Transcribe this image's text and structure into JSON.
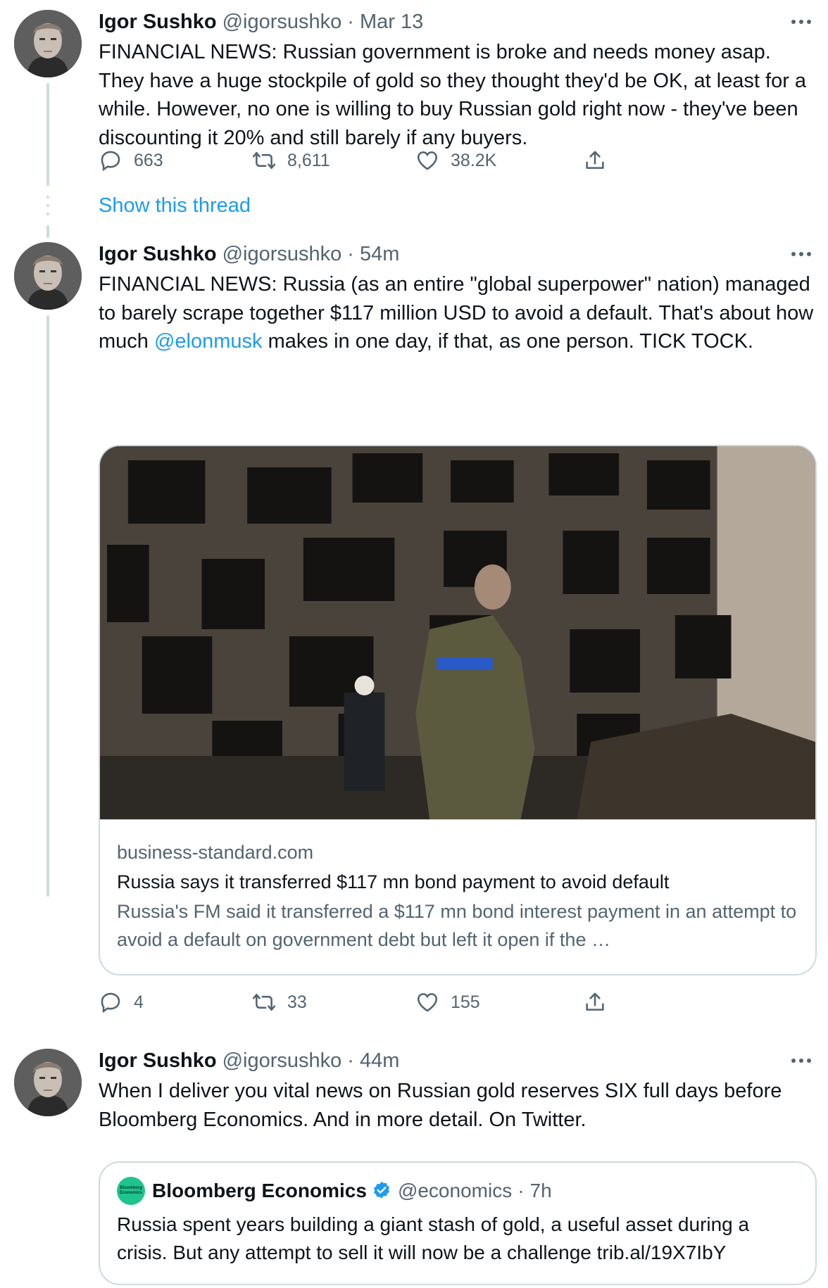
{
  "colors": {
    "link": "#1d9bf0",
    "muted": "#536471",
    "border": "#cfd9de",
    "text": "#0f1419"
  },
  "tweets": [
    {
      "name": "Igor Sushko",
      "handle": "@igorsushko",
      "separator": "·",
      "time": "Mar 13",
      "text": "FINANCIAL NEWS: Russian government is broke and needs money asap. They have a huge stockpile of gold so they thought they'd be OK, at least for a while. However, no one is willing to buy Russian gold right now - they've been discounting it 20% and still barely if any buyers.",
      "replies": "663",
      "retweets": "8,611",
      "likes": "38.2K"
    },
    {
      "name": "Igor Sushko",
      "handle": "@igorsushko",
      "separator": "·",
      "time": "54m",
      "text_before": "FINANCIAL NEWS: Russia (as an entire \"global superpower\" nation) managed to barely scrape together $117 million USD to avoid a default. That's about how much ",
      "mention": "@elonmusk",
      "text_after": " makes in one day, if that, as one person. TICK TOCK.",
      "card": {
        "domain": "business-standard.com",
        "title": "Russia says it transferred $117 mn bond payment to avoid default",
        "description": "Russia's FM said it transferred a $117 mn bond interest payment in an attempt to avoid a default on government debt but left it open if the …"
      },
      "replies": "4",
      "retweets": "33",
      "likes": "155"
    },
    {
      "name": "Igor Sushko",
      "handle": "@igorsushko",
      "separator": "·",
      "time": "44m",
      "text": "When I deliver you vital news on Russian gold reserves SIX full days before Bloomberg Economics. And in more detail. On Twitter.",
      "quote": {
        "name": "Bloomberg Economics",
        "handle": "@economics",
        "separator": "·",
        "time": "7h",
        "text": "Russia spent years building a giant stash of gold, a useful asset during a crisis. But any attempt to sell it will now be a challenge trib.al/19X7IbY",
        "logo_line1": "Bloomberg",
        "logo_line2": "Economics"
      }
    }
  ],
  "show_thread": "Show this thread",
  "icons": [
    "more-icon",
    "reply-icon",
    "retweet-icon",
    "like-icon",
    "share-icon",
    "verified-icon"
  ]
}
